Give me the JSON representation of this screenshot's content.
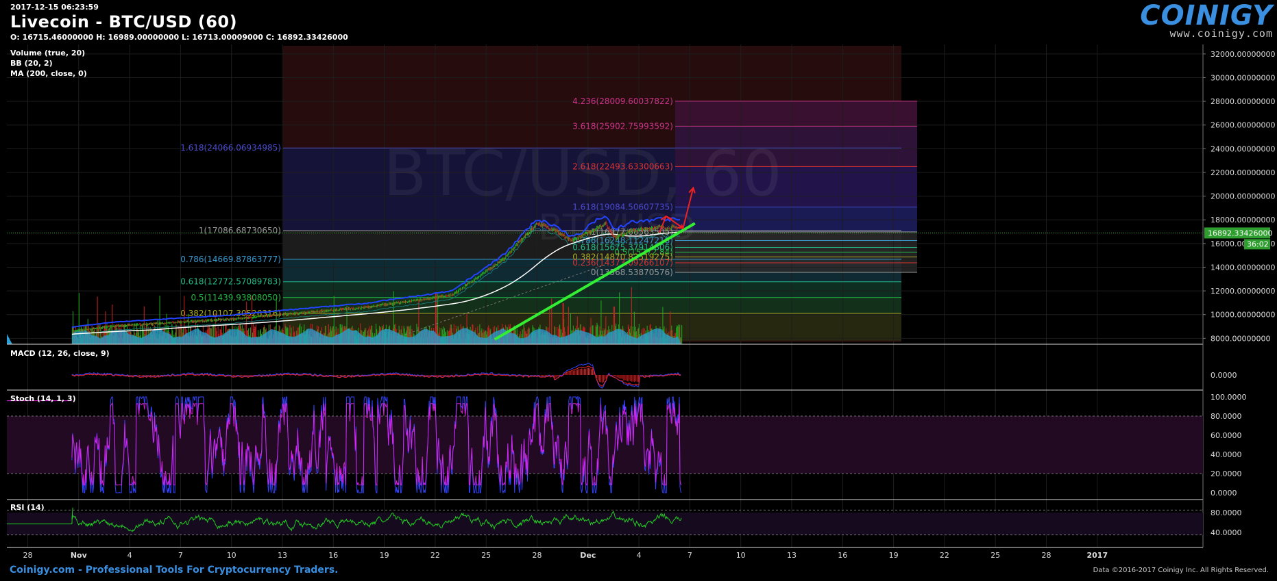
{
  "header": {
    "timestamp": "2017-12-15 06:23:59",
    "title": "Livecoin - BTC/USD (60)",
    "ohlc": "O: 16715.46000000 H: 16989.00000000 L: 16713.00009000 C: 16892.33426000",
    "watermark_main": "BTC/USD, 60",
    "watermark_sub": "BTC/USD"
  },
  "indicators": {
    "volume": "Volume (true, 20)",
    "bb": "BB (20, 2)",
    "ma": "MA (200, close, 0)",
    "macd": "MACD (12, 26, close, 9)",
    "stoch": "Stoch (14, 1, 3)",
    "rsi": "RSI (14)"
  },
  "logo": {
    "main": "COINIGY",
    "sub": "www.coinigy.com"
  },
  "footer": {
    "left": "Coinigy.com - Professional Tools For Cryptocurrency Traders.",
    "right": "Data ©2016-2017 Coinigy Inc. All Rights Reserved."
  },
  "colors": {
    "price_up": "#22aa22",
    "price_down": "#cc2222",
    "volume": "#2a9fd6",
    "trendline": "#33ee33",
    "ma": "#ffffff",
    "bb": "#2244ff",
    "macd_line": "#3344ff",
    "macd_signal": "#ee2222",
    "stoch_k": "#3344ff",
    "stoch_d": "#ee22ee",
    "rsi": "#22cc22",
    "last_price_badge": "#2e9e2e"
  },
  "chart_data": [
    {
      "type": "candlestick",
      "pane": "price",
      "ylim": [
        7500,
        32800
      ],
      "yticks": [
        "32000.00000000",
        "30000.00000000",
        "28000.00000000",
        "26000.00000000",
        "24000.00000000",
        "22000.00000000",
        "20000.00000000",
        "18000.00000000",
        "16000.00000000",
        "14000.00000000",
        "12000.00000000",
        "10000.00000000",
        "8000.00000000"
      ],
      "ytick_values": [
        32000,
        30000,
        28000,
        26000,
        24000,
        22000,
        20000,
        18000,
        16000,
        14000,
        12000,
        10000,
        8000
      ],
      "xticks": [
        "28",
        "Nov",
        "4",
        "7",
        "10",
        "13",
        "16",
        "19",
        "22",
        "25",
        "28",
        "Dec",
        "4",
        "7",
        "10",
        "13",
        "16",
        "19",
        "22",
        "25",
        "28",
        "2017"
      ],
      "last_price": "16892.33426000",
      "last_price_value": 16892.33,
      "countdown": "36:02",
      "price_path": [
        [
          0,
          0.055
        ],
        [
          5,
          0.14
        ],
        [
          12,
          0.2
        ],
        [
          20,
          0.3
        ],
        [
          25,
          0.4
        ],
        [
          28,
          0.7
        ],
        [
          30,
          1.0
        ],
        [
          31,
          0.95
        ],
        [
          32,
          0.85
        ],
        [
          33,
          0.92
        ],
        [
          34,
          1.0
        ],
        [
          34.6,
          0.88
        ],
        [
          35.5,
          0.94
        ],
        [
          36.3,
          0.95
        ],
        [
          37,
          0.97
        ],
        [
          38.5,
          0.96
        ]
      ],
      "close_min": 7600,
      "close_max": 17700,
      "fib_left": [
        {
          "label": "1.618(24066.06934985)",
          "value": 24066.07,
          "color": "#4a4ad0"
        },
        {
          "label": "1(17086.68730650)",
          "value": 17086.69,
          "color": "#999999"
        },
        {
          "label": "0.786(14669.87863777)",
          "value": 14669.88,
          "color": "#3a9ad0"
        },
        {
          "label": "0.618(12772.57089783)",
          "value": 12772.57,
          "color": "#22bb88"
        },
        {
          "label": "0.5(11439.93808050)",
          "value": 11439.94,
          "color": "#22bb44"
        },
        {
          "label": "0.382(10107.30526316)",
          "value": 10107.31,
          "color": "#aaaa22"
        }
      ],
      "fib_right": [
        {
          "label": "4.236(28009.60037822)",
          "value": 28009.6,
          "color": "#cc3388"
        },
        {
          "label": "3.618(25902.75993592)",
          "value": 25902.76,
          "color": "#cc3388"
        },
        {
          "label": "2.618(22493.63300663)",
          "value": 22493.63,
          "color": "#dd3333"
        },
        {
          "label": "1.618(19084.50607735)",
          "value": 19084.51,
          "color": "#4a4ad0"
        },
        {
          "label": "1(16977.66563505)",
          "value": 16977.67,
          "color": "#999999"
        },
        {
          "label": "0.786(16248.11247218)",
          "value": 16248.11,
          "color": "#3a9ad0"
        },
        {
          "label": "0.618(15675.37914806)",
          "value": 15675.38,
          "color": "#22bb88"
        },
        {
          "label": "0.5(15272.84)",
          "value": 15272.84,
          "color": "#22bb44"
        },
        {
          "label": "0.382(14870.82519275)",
          "value": 14870.83,
          "color": "#aaaa22"
        },
        {
          "label": "0.236(14373.09266107)",
          "value": 14373.09,
          "color": "#dd3333"
        },
        {
          "label": "0(13568.53870576)",
          "value": 13568.54,
          "color": "#999999"
        }
      ]
    },
    {
      "type": "line",
      "pane": "macd",
      "ytick": "0.0000"
    },
    {
      "type": "line",
      "pane": "stoch",
      "yticks": [
        "100.0000",
        "80.0000",
        "60.0000",
        "40.0000",
        "20.0000",
        "0.0000"
      ],
      "ytick_values": [
        100,
        80,
        60,
        40,
        20,
        0
      ]
    },
    {
      "type": "line",
      "pane": "rsi",
      "yticks": [
        "80.0000",
        "40.0000"
      ],
      "ytick_values": [
        80,
        40
      ]
    }
  ]
}
